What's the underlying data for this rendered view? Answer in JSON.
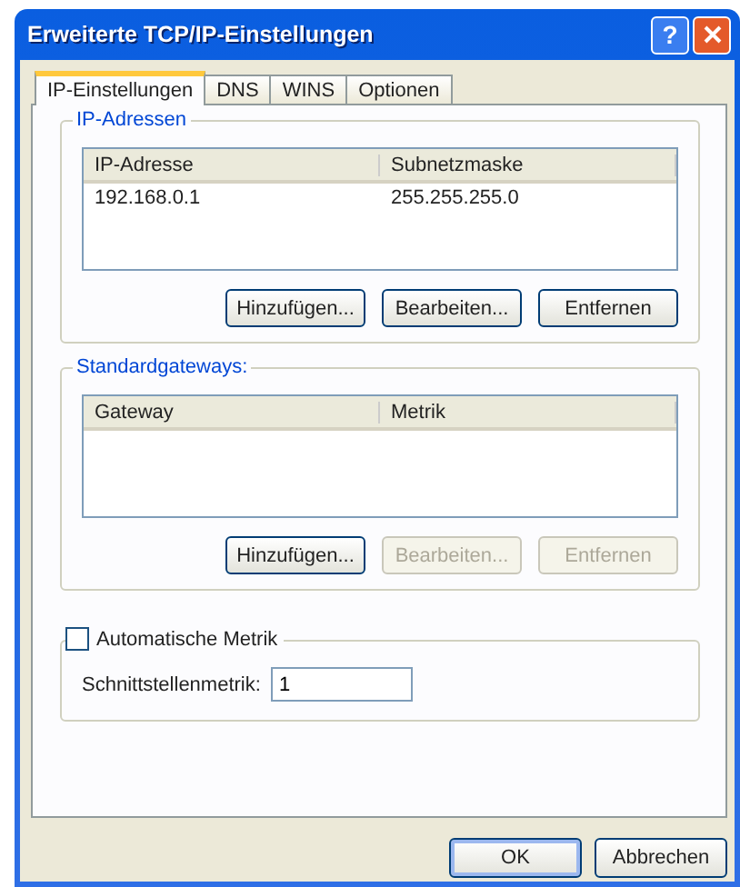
{
  "window": {
    "title": "Erweiterte TCP/IP-Einstellungen",
    "help_button": "?"
  },
  "tabs": [
    {
      "label": "IP-Einstellungen",
      "selected": true
    },
    {
      "label": "DNS",
      "selected": false
    },
    {
      "label": "WINS",
      "selected": false
    },
    {
      "label": "Optionen",
      "selected": false
    }
  ],
  "ip_addresses": {
    "title": "IP-Adressen",
    "columns": [
      "IP-Adresse",
      "Subnetzmaske"
    ],
    "rows": [
      [
        "192.168.0.1",
        "255.255.255.0"
      ]
    ],
    "buttons": [
      {
        "label": "Hinzufügen...",
        "disabled": false
      },
      {
        "label": "Bearbeiten...",
        "disabled": false
      },
      {
        "label": "Entfernen",
        "disabled": false
      }
    ]
  },
  "gateways": {
    "title": "Standardgateways:",
    "columns": [
      "Gateway",
      "Metrik"
    ],
    "buttons": [
      {
        "label": "Hinzufügen...",
        "disabled": false
      },
      {
        "label": "Bearbeiten...",
        "disabled": true
      },
      {
        "label": "Entfernen",
        "disabled": true
      }
    ]
  },
  "metric": {
    "checkbox": {
      "label": "Automatische Metrik",
      "checked": false
    },
    "field_label": "Schnittstellenmetrik:",
    "value": "1"
  },
  "buttons": [
    {
      "label": "OK"
    },
    {
      "label": "Abbrechen"
    }
  ]
}
